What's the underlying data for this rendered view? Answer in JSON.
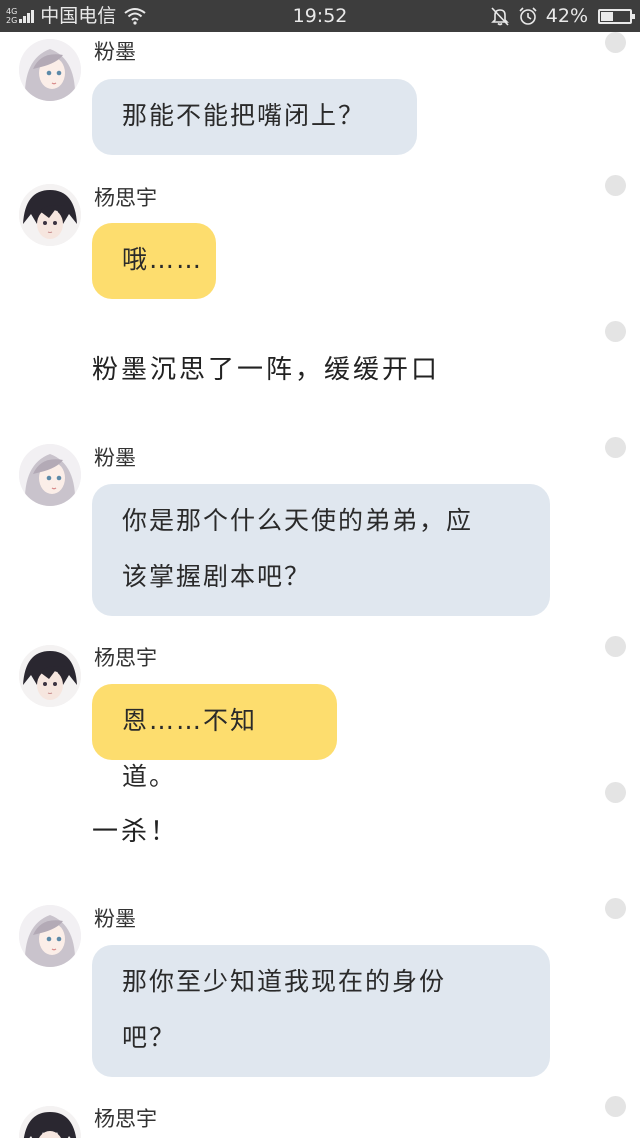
{
  "status_bar": {
    "network_top": "4G",
    "network_bottom": "2G",
    "carrier": "中国电信",
    "time": "19:52",
    "battery_percent": "42%",
    "battery_level": 0.42
  },
  "messages": [
    {
      "kind": "message",
      "sender": "粉墨",
      "text_lines": [
        "那能不能把嘴闭上？"
      ],
      "bubble_color": "#e0e7ef"
    },
    {
      "kind": "message",
      "sender": "杨思宇",
      "text_lines": [
        "哦……"
      ],
      "bubble_color": "#fddd6e"
    },
    {
      "kind": "narration",
      "text": "粉墨沉思了一阵，缓缓开口"
    },
    {
      "kind": "message",
      "sender": "粉墨",
      "text_lines": [
        "你是那个什么天使的弟弟，应",
        "该掌握剧本吧？"
      ],
      "bubble_color": "#e0e7ef"
    },
    {
      "kind": "message",
      "sender": "杨思宇",
      "text_lines": [
        "恩……不知道。"
      ],
      "bubble_color": "#fddd6e"
    },
    {
      "kind": "narration",
      "text": "一杀！"
    },
    {
      "kind": "message",
      "sender": "粉墨",
      "text_lines": [
        "那你至少知道我现在的身份",
        "吧？"
      ],
      "bubble_color": "#e0e7ef"
    },
    {
      "kind": "message",
      "sender": "杨思宇",
      "text_lines": [],
      "bubble_color": ""
    }
  ]
}
